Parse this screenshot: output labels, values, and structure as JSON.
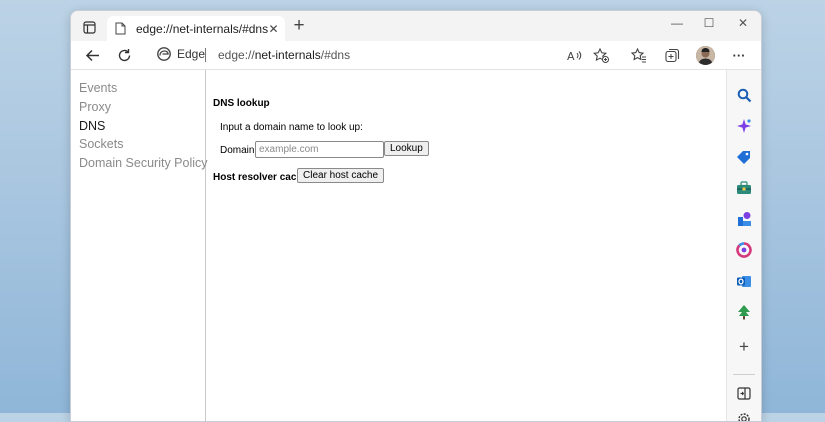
{
  "browser": {
    "tab": {
      "title": "edge://net-internals/#dns",
      "close_glyph": "✕"
    },
    "new_tab_glyph": "+",
    "window_controls": {
      "minimize": "—",
      "maximize": "☐",
      "close": "✕"
    },
    "address": {
      "site_label": "Edge",
      "url_prefix": "edge://",
      "url_host": "net-internals",
      "url_path": "/#dns"
    },
    "more_glyph": "···"
  },
  "nav": {
    "items": [
      {
        "label": "Events",
        "active": false
      },
      {
        "label": "Proxy",
        "active": false
      },
      {
        "label": "DNS",
        "active": true
      },
      {
        "label": "Sockets",
        "active": false
      },
      {
        "label": "Domain Security Policy",
        "active": false
      }
    ]
  },
  "dns": {
    "heading": "DNS lookup",
    "prompt": "Input a domain name to look up:",
    "domain_label": "Domain:",
    "domain_value": "",
    "domain_placeholder": "example.com",
    "lookup_label": "Lookup",
    "cache_heading": "Host resolver cache",
    "clear_label": "Clear host cache"
  },
  "sidebar": {
    "icons": [
      "search-icon",
      "copilot-icon",
      "tag-icon",
      "toolbox-icon",
      "games-icon",
      "microsoft365-icon",
      "outlook-icon",
      "tree-icon",
      "add-icon",
      "split-screen-icon",
      "settings-icon"
    ],
    "add_glyph": "+"
  },
  "colors": {
    "accent": "#0f6cbd",
    "window_bg": "#ffffff",
    "titlebar_bg": "#f3f3f3"
  }
}
